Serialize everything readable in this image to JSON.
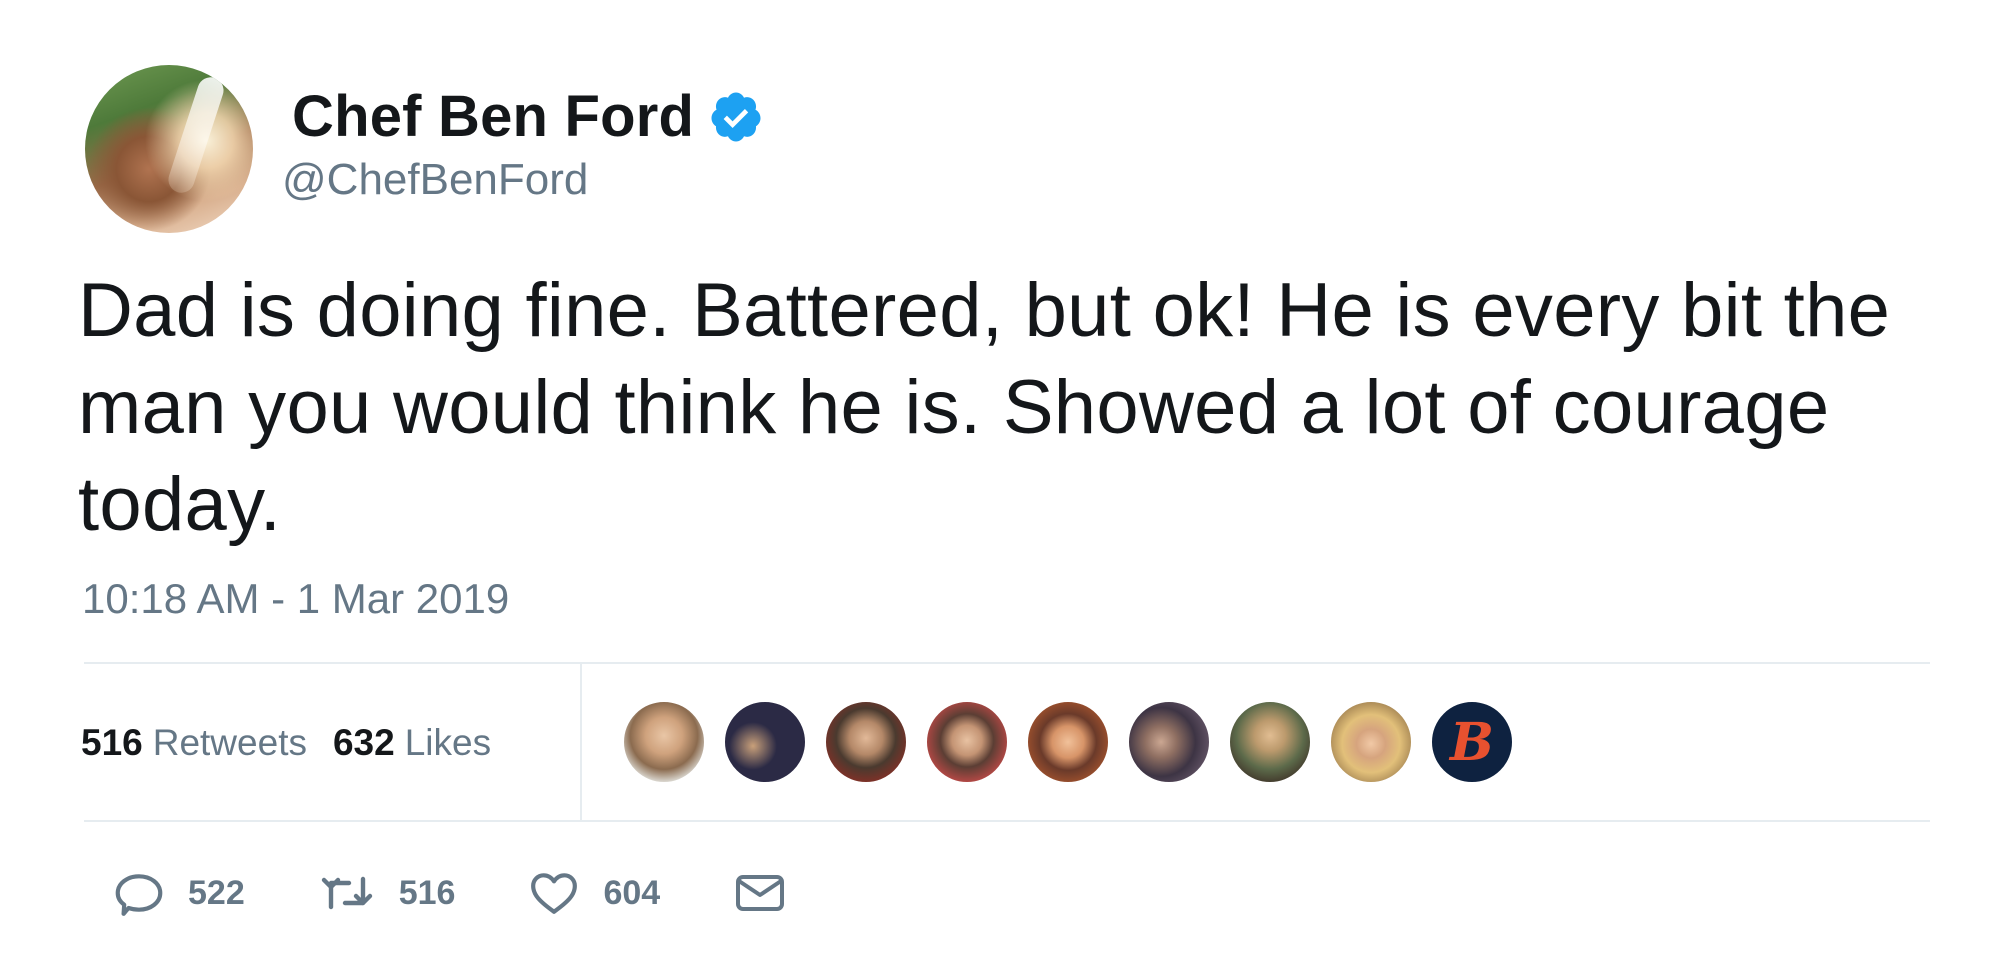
{
  "author": {
    "display_name": "Chef Ben Ford",
    "handle": "@ChefBenFord",
    "verified": true,
    "verified_color": "#1da1f2"
  },
  "tweet": {
    "text": "Dad is doing fine. Battered, but ok! He is every bit the man you would think he is. Showed a lot of courage today.",
    "timestamp": "10:18 AM - 1 Mar 2019"
  },
  "stats": {
    "retweets_count": "516",
    "retweets_label": "Retweets",
    "likes_count": "632",
    "likes_label": "Likes"
  },
  "likers": {
    "b_logo_text": "B"
  },
  "actions": {
    "replies": "522",
    "retweets": "516",
    "likes": "604"
  },
  "colors": {
    "text_primary": "#14171a",
    "text_secondary": "#657786",
    "divider": "#e6ecf0"
  }
}
